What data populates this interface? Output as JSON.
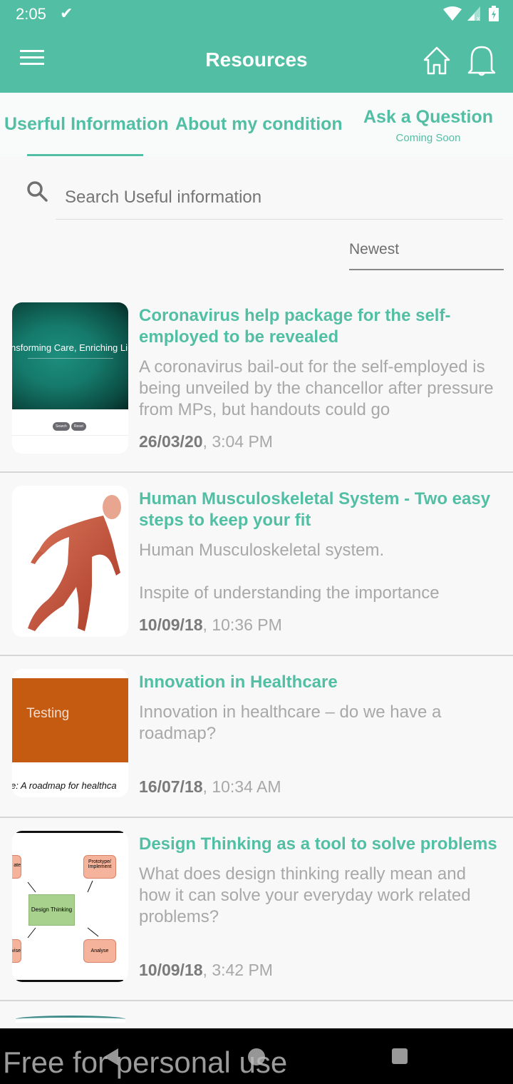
{
  "status_bar": {
    "time": "2:05",
    "icons": [
      "check-icon",
      "wifi-icon",
      "signal-icon",
      "battery-charging-icon"
    ]
  },
  "app_bar": {
    "title": "Resources",
    "left_icon": "menu-icon",
    "right_icons": [
      "home-icon",
      "bell-icon"
    ]
  },
  "colors": {
    "accent": "#52bfa5",
    "text_muted": "#a8a8a8",
    "date_bold": "#7a7a7a"
  },
  "tabs": [
    {
      "label": "Userful Information",
      "active": true
    },
    {
      "label": "About my condition",
      "active": false
    },
    {
      "label": "Ask a Question",
      "sublabel": "Coming Soon",
      "active": false
    }
  ],
  "search": {
    "placeholder": "Search Useful information",
    "value": ""
  },
  "sort": {
    "selected": "Newest"
  },
  "articles": [
    {
      "title": "Coronavirus help package for the self-employed to be revealed",
      "description": "A coronavirus bail-out for the self-employed is being unveiled by the chancellor after pressure from MPs, but handouts could go",
      "date": "26/03/20",
      "time": "3:04 PM",
      "thumbnail": {
        "caption": "nsforming Care, Enriching Li",
        "buttons": [
          "Search",
          "Reset"
        ]
      }
    },
    {
      "title": "Human Musculoskeletal System - Two easy steps to keep your fit",
      "description": "Human Musculoskeletal system.",
      "description2": "Inspite of understanding the importance",
      "date": "10/09/18",
      "time": "10:36 PM",
      "thumbnail": {
        "caption": ""
      }
    },
    {
      "title": "Innovation in Healthcare",
      "description": "Innovation in healthcare – do we have a roadmap?",
      "date": "16/07/18",
      "time": "10:34 AM",
      "thumbnail": {
        "caption": "Testing",
        "footer": "e: A roadmap for healthca"
      }
    },
    {
      "title": "Design Thinking as a tool to solve problems",
      "description": "What does design thinking really mean and how it can solve your everyday work related problems?",
      "date": "10/09/18",
      "time": "3:42 PM",
      "thumbnail": {
        "center": "Design Thinking",
        "nodes": [
          "ate",
          "Prototype/ Implement",
          "vise",
          "Analyse"
        ]
      }
    }
  ],
  "watermark": "Free for personal use"
}
